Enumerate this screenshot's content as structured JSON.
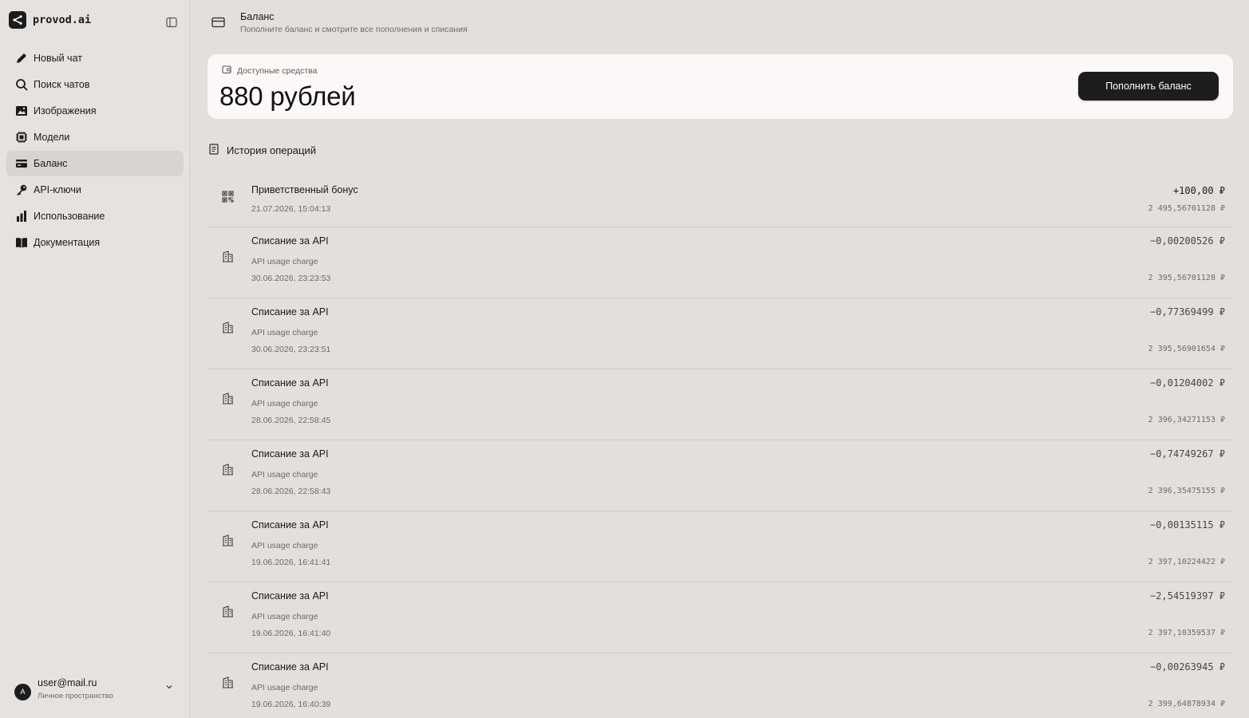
{
  "brand": {
    "name": "provod.ai",
    "logo_icon": "share-nodes-icon"
  },
  "sidebar": {
    "items": [
      {
        "label": "Новый чат",
        "icon": "pencil-icon"
      },
      {
        "label": "Поиск чатов",
        "icon": "search-icon"
      },
      {
        "label": "Изображения",
        "icon": "image-icon"
      },
      {
        "label": "Модели",
        "icon": "chip-icon"
      },
      {
        "label": "Баланс",
        "icon": "card-icon",
        "active": true
      },
      {
        "label": "API-ключи",
        "icon": "key-icon"
      },
      {
        "label": "Использование",
        "icon": "bar-chart-icon"
      },
      {
        "label": "Документация",
        "icon": "book-icon"
      }
    ]
  },
  "user": {
    "initial": "A",
    "email": "user@mail.ru",
    "workspace": "Личное пространство"
  },
  "header": {
    "title": "Баланс",
    "subtitle": "Пополните баланс и смотрите все пополнения и списания"
  },
  "balance": {
    "label": "Доступные средства",
    "amount": "880 рублей",
    "topup_label": "Пополнить баланс"
  },
  "history": {
    "title": "История операций",
    "transactions": [
      {
        "title": "Приветственный бонус",
        "description": "",
        "date": "21.07.2026, 15:04:13",
        "amount": "+100,00 ₽",
        "balance_after": "2 495,56701128 ₽",
        "icon": "qr-icon"
      },
      {
        "title": "Списание за API",
        "description": "API usage charge",
        "date": "30.06.2026, 23:23:53",
        "amount": "−0,00200526 ₽",
        "balance_after": "2 395,56701128 ₽",
        "icon": "building-icon"
      },
      {
        "title": "Списание за API",
        "description": "API usage charge",
        "date": "30.06.2026, 23:23:51",
        "amount": "−0,77369499 ₽",
        "balance_after": "2 395,56901654 ₽",
        "icon": "building-icon"
      },
      {
        "title": "Списание за API",
        "description": "API usage charge",
        "date": "28.06.2026, 22:58:45",
        "amount": "−0,01204002 ₽",
        "balance_after": "2 396,34271153 ₽",
        "icon": "building-icon"
      },
      {
        "title": "Списание за API",
        "description": "API usage charge",
        "date": "28.06.2026, 22:58:43",
        "amount": "−0,74749267 ₽",
        "balance_after": "2 396,35475155 ₽",
        "icon": "building-icon"
      },
      {
        "title": "Списание за API",
        "description": "API usage charge",
        "date": "19.06.2026, 16:41:41",
        "amount": "−0,00135115 ₽",
        "balance_after": "2 397,10224422 ₽",
        "icon": "building-icon"
      },
      {
        "title": "Списание за API",
        "description": "API usage charge",
        "date": "19.06.2026, 16:41:40",
        "amount": "−2,54519397 ₽",
        "balance_after": "2 397,10359537 ₽",
        "icon": "building-icon"
      },
      {
        "title": "Списание за API",
        "description": "API usage charge",
        "date": "19.06.2026, 16:40:39",
        "amount": "−0,00263945 ₽",
        "balance_after": "2 399,64878934 ₽",
        "icon": "building-icon"
      }
    ]
  }
}
